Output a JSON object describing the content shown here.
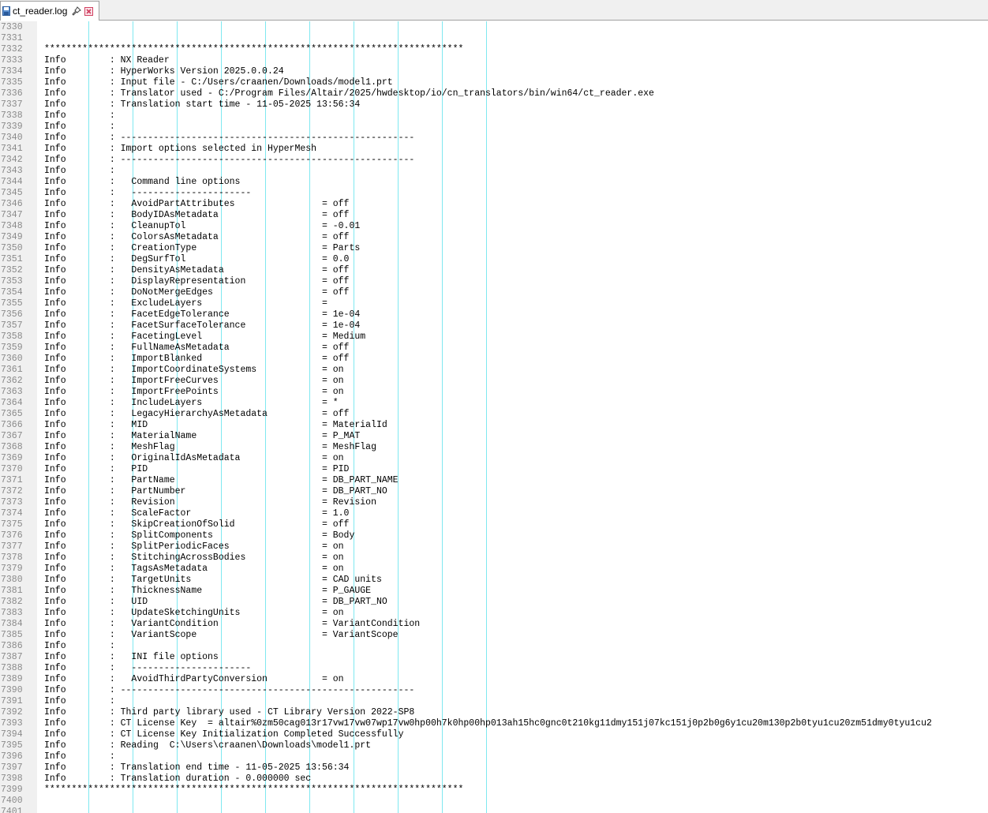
{
  "tab": {
    "filename": "ct_reader.log"
  },
  "colors": {
    "gutter_bg": "#f0f0f0",
    "guide": "#7fe8f0",
    "line_number": "#8a8a8a",
    "close_icon": "#d04060"
  },
  "editor": {
    "first_line": 7330,
    "lines": [
      "",
      "",
      "*****************************************************************************",
      "Info        : NX Reader",
      "Info        : HyperWorks Version 2025.0.0.24",
      "Info        : Input file - C:/Users/craanen/Downloads/model1.prt",
      "Info        : Translator used - C:/Program Files/Altair/2025/hwdesktop/io/cn_translators/bin/win64/ct_reader.exe",
      "Info        : Translation start time - 11-05-2025 13:56:34",
      "Info        :",
      "Info        :",
      "Info        : ------------------------------------------------------",
      "Info        : Import options selected in HyperMesh",
      "Info        : ------------------------------------------------------",
      "Info        :",
      "Info        :   Command line options",
      "Info        :   ----------------------",
      "Info        :   AvoidPartAttributes                = off",
      "Info        :   BodyIDAsMetadata                   = off",
      "Info        :   CleanupTol                         = -0.01",
      "Info        :   ColorsAsMetadata                   = off",
      "Info        :   CreationType                       = Parts",
      "Info        :   DegSurfTol                         = 0.0",
      "Info        :   DensityAsMetadata                  = off",
      "Info        :   DisplayRepresentation              = off",
      "Info        :   DoNotMergeEdges                    = off",
      "Info        :   ExcludeLayers                      =",
      "Info        :   FacetEdgeTolerance                 = 1e-04",
      "Info        :   FacetSurfaceTolerance              = 1e-04",
      "Info        :   FacetingLevel                      = Medium",
      "Info        :   FullNameAsMetadata                 = off",
      "Info        :   ImportBlanked                      = off",
      "Info        :   ImportCoordinateSystems            = on",
      "Info        :   ImportFreeCurves                   = on",
      "Info        :   ImportFreePoints                   = on",
      "Info        :   IncludeLayers                      = *",
      "Info        :   LegacyHierarchyAsMetadata          = off",
      "Info        :   MID                                = MaterialId",
      "Info        :   MaterialName                       = P_MAT",
      "Info        :   MeshFlag                           = MeshFlag",
      "Info        :   OriginalIdAsMetadata               = on",
      "Info        :   PID                                = PID",
      "Info        :   PartName                           = DB_PART_NAME",
      "Info        :   PartNumber                         = DB_PART_NO",
      "Info        :   Revision                           = Revision",
      "Info        :   ScaleFactor                        = 1.0",
      "Info        :   SkipCreationOfSolid                = off",
      "Info        :   SplitComponents                    = Body",
      "Info        :   SplitPeriodicFaces                 = on",
      "Info        :   StitchingAcrossBodies              = on",
      "Info        :   TagsAsMetadata                     = on",
      "Info        :   TargetUnits                        = CAD units",
      "Info        :   ThicknessName                      = P_GAUGE",
      "Info        :   UID                                = DB_PART_NO",
      "Info        :   UpdateSketchingUnits               = on",
      "Info        :   VariantCondition                   = VariantCondition",
      "Info        :   VariantScope                       = VariantScope",
      "Info        :",
      "Info        :   INI file options",
      "Info        :   ----------------------",
      "Info        :   AvoidThirdPartyConversion          = on",
      "Info        : ------------------------------------------------------",
      "Info        :",
      "Info        : Third party library used - CT Library Version 2022-SP8",
      "Info        : CT License Key  = altair%0zm50cag013r17vw17vw07wp17vw0hp00h7k0hp00hp013ah15hc0gnc0t210kg11dmy151j07kc151j0p2b0g6y1cu20m130p2b0tyu1cu20zm51dmy0tyu1cu2",
      "Info        : CT License Key Initialization Completed Successfully",
      "Info        : Reading  C:\\Users\\craanen\\Downloads\\model1.prt",
      "Info        :",
      "Info        : Translation end time - 11-05-2025 13:56:34",
      "Info        : Translation duration - 0.000000 sec",
      "*****************************************************************************",
      "",
      ""
    ]
  }
}
